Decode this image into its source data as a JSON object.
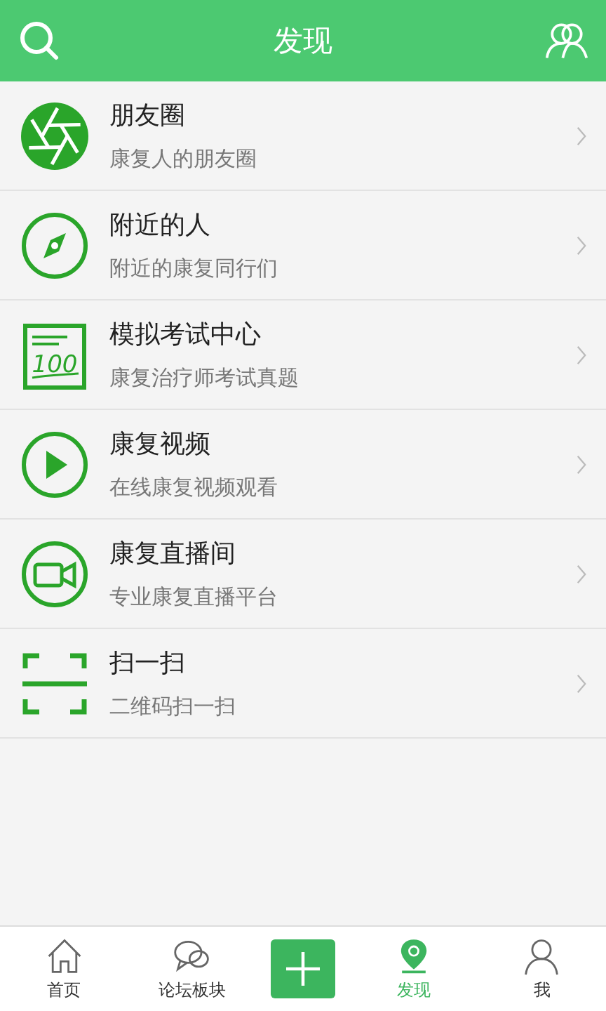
{
  "header": {
    "title": "发现"
  },
  "items": [
    {
      "kind": "aperture",
      "title": "朋友圈",
      "subtitle": "康复人的朋友圈"
    },
    {
      "kind": "compass",
      "title": "附近的人",
      "subtitle": "附近的康复同行们"
    },
    {
      "kind": "exam",
      "title": "模拟考试中心",
      "subtitle": "康复治疗师考试真题",
      "badge_text": "100"
    },
    {
      "kind": "play",
      "title": "康复视频",
      "subtitle": "在线康复视频观看"
    },
    {
      "kind": "camera",
      "title": "康复直播间",
      "subtitle": "专业康复直播平台"
    },
    {
      "kind": "scan",
      "title": "扫一扫",
      "subtitle": "二维码扫一扫"
    }
  ],
  "tabbar": [
    {
      "kind": "home",
      "label": "首页",
      "selected": false
    },
    {
      "kind": "forum",
      "label": "论坛板块",
      "selected": false
    },
    {
      "kind": "add"
    },
    {
      "kind": "discover",
      "label": "发现",
      "selected": true
    },
    {
      "kind": "me",
      "label": "我",
      "selected": false
    }
  ]
}
